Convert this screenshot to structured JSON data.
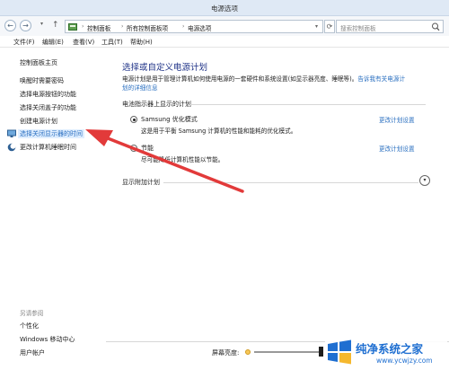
{
  "window": {
    "title": "电源选项"
  },
  "nav": {
    "breadcrumb": [
      "控制面板",
      "所有控制面板项",
      "电源选项"
    ],
    "search_placeholder": "搜索控制面板"
  },
  "menu": [
    "文件(F)",
    "编辑(E)",
    "查看(V)",
    "工具(T)",
    "帮助(H)"
  ],
  "sidebar": {
    "home": "控制面板主页",
    "links": [
      "唤醒时需要密码",
      "选择电源按钮的功能",
      "选择关闭盖子的功能",
      "创建电源计划",
      "选择关闭显示器的时间",
      "更改计算机睡眠时间"
    ],
    "see_also_title": "另请参阅",
    "see_also": [
      "个性化",
      "Windows 移动中心",
      "用户帐户"
    ]
  },
  "main": {
    "heading": "选择或自定义电源计划",
    "desc_line1": "电源计划是用于管理计算机如何使用电源的一套硬件和系统设置(如显示器亮度、睡眠等)。",
    "desc_link1": "告诉我有关电源计",
    "desc_link2": "划的详细信息",
    "section_title": "电池指示器上显示的计划",
    "plans": [
      {
        "name": "Samsung 优化模式",
        "desc": "这是用于平衡 Samsung 计算机的性能和能耗的优化模式。",
        "link": "更改计划设置",
        "selected": true
      },
      {
        "name": "节能",
        "desc": "尽可能降低计算机性能以节能。",
        "link": "更改计划设置",
        "selected": false
      }
    ],
    "extra_plans": "显示附加计划",
    "brightness_label": "屏幕亮度:"
  },
  "watermark": {
    "title": "纯净系统之家",
    "url": "www.ycwjzy.com"
  },
  "colors": {
    "link": "#2a6fc0",
    "heading": "#1e3287",
    "annotation_arrow": "#e23a3a"
  }
}
